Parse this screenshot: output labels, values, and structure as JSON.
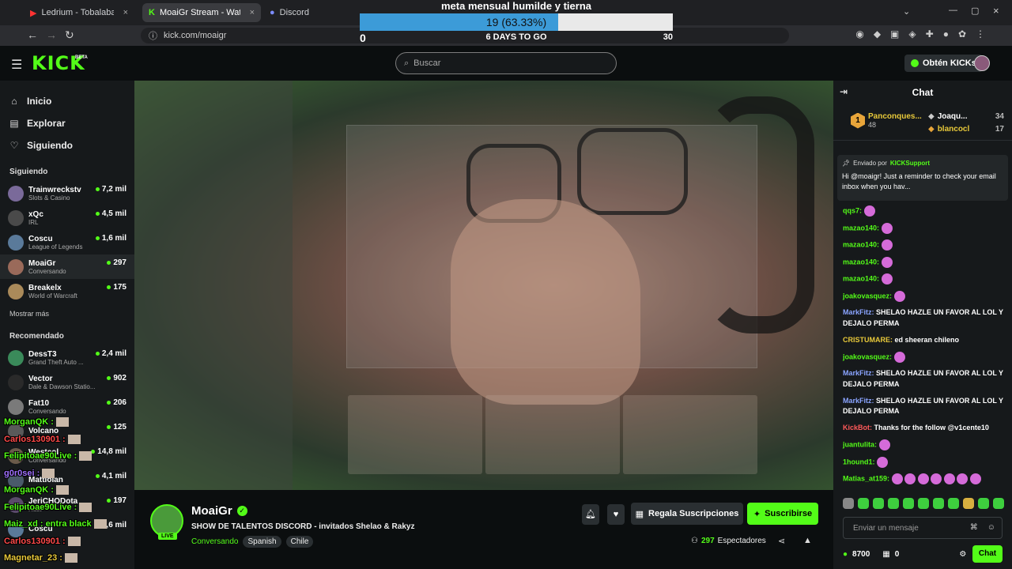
{
  "browser": {
    "tabs": [
      {
        "label": "Ledrium - Tobalaba, MUT, Av. P",
        "active": false
      },
      {
        "label": "MoaiGr Stream - Watch Liv",
        "active": true
      },
      {
        "label": "Discord",
        "active": false
      }
    ],
    "url": "kick.com/moaigr"
  },
  "goal": {
    "title": "meta mensual humilde y tierna",
    "progress_text": "19 (63.33%)",
    "progress_fraction": 0.6333,
    "days_left": "6 DAYS TO GO",
    "min": "0",
    "max": "30"
  },
  "header": {
    "logo": "KICK",
    "beta": "BETA",
    "search_placeholder": "Buscar",
    "get_kicks": "Obtén KICKs"
  },
  "sidebar": {
    "nav": [
      {
        "label": "Inicio",
        "icon": "home-icon",
        "glyph": "⌂"
      },
      {
        "label": "Explorar",
        "icon": "browse-icon",
        "glyph": "▤"
      },
      {
        "label": "Siguiendo",
        "icon": "heart-icon",
        "glyph": "♡"
      }
    ],
    "following_title": "Siguiendo",
    "following": [
      {
        "name": "Trainwreckstv",
        "category": "Slots & Casino",
        "viewers": "7,2 mil",
        "color": "#7a6a9a"
      },
      {
        "name": "xQc",
        "category": "IRL",
        "viewers": "4,5 mil",
        "color": "#4a4a4a"
      },
      {
        "name": "Coscu",
        "category": "League of Legends",
        "viewers": "1,6 mil",
        "color": "#5a7a9a"
      },
      {
        "name": "MoaiGr",
        "category": "Conversando",
        "viewers": "297",
        "color": "#9a6a5a"
      },
      {
        "name": "Breakelx",
        "category": "World of Warcraft",
        "viewers": "175",
        "color": "#aa8a5a"
      }
    ],
    "show_more": "Mostrar más",
    "recommended_title": "Recomendado",
    "recommended": [
      {
        "name": "DessT3",
        "category": "Grand Theft Auto ...",
        "viewers": "2,4 mil",
        "color": "#3a8a5a"
      },
      {
        "name": "Vector",
        "category": "Dale & Dawson Statio...",
        "viewers": "902",
        "color": "#2a2a2a"
      },
      {
        "name": "Fat10",
        "category": "Conversando",
        "viewers": "206",
        "color": "#7a7a7a"
      },
      {
        "name": "Volcano",
        "category": "",
        "viewers": "125",
        "color": "#5a5a5a"
      },
      {
        "name": "Westcol",
        "category": "Conversando",
        "viewers": "14,8 mil",
        "color": "#6a5a4a"
      },
      {
        "name": "Mattiolan",
        "category": "",
        "viewers": "4,1 mil",
        "color": "#4a5a6a"
      },
      {
        "name": "JeriCHODota",
        "category": "Rust",
        "viewers": "197",
        "color": "#5a4a6a"
      },
      {
        "name": "Coscu",
        "category": "",
        "viewers": "1,6 mil",
        "color": "#5a7a9a"
      }
    ]
  },
  "overlay_chat": [
    {
      "user": "MorganQK :",
      "color": "#53fc18"
    },
    {
      "user": "Carlos130901 :",
      "color": "#ff4a4a"
    },
    {
      "user": "Felipitoae90Live :",
      "color": "#53fc18"
    },
    {
      "user": "g0r0sei :",
      "color": "#a070ff"
    },
    {
      "user": "MorganQK :",
      "color": "#53fc18"
    },
    {
      "user": "Felipitoae90Live :",
      "color": "#53fc18"
    },
    {
      "user": "Maiz_xd : entra black",
      "color": "#53fc18"
    },
    {
      "user": "Carlos130901 :",
      "color": "#ff4a4a"
    },
    {
      "user": "Magnetar_23 :",
      "color": "#e8c93a"
    }
  ],
  "stream": {
    "name": "MoaiGr",
    "title": "SHOW DE TALENTOS DISCORD - invitados Shelao & Rakyz",
    "category": "Conversando",
    "tags": [
      "Spanish",
      "Chile"
    ],
    "live_label": "LIVE",
    "gift_label": "Regala Suscripciones",
    "subscribe_label": "Suscribirse",
    "viewers": "297",
    "viewers_label": "Espectadores"
  },
  "chat": {
    "title": "Chat",
    "leader_top": {
      "rank": "1",
      "name": "Panconques...",
      "count": "48"
    },
    "leader_rows": [
      {
        "name": "Joaqu...",
        "count": "34"
      },
      {
        "name": "blancocl",
        "count": "17"
      }
    ],
    "pinned": {
      "label": "Enviado por",
      "by": "KICKSupport",
      "text": "Hi @moaigr! Just a reminder to check your email inbox when you hav..."
    },
    "messages": [
      {
        "user": "qqs7:",
        "text": "",
        "emote": true,
        "cls": ""
      },
      {
        "user": "mazao140:",
        "text": "",
        "emote": true,
        "cls": ""
      },
      {
        "user": "mazao140:",
        "text": "",
        "emote": true,
        "cls": ""
      },
      {
        "user": "mazao140:",
        "text": "",
        "emote": true,
        "cls": ""
      },
      {
        "user": "mazao140:",
        "text": "",
        "emote": true,
        "cls": ""
      },
      {
        "user": "joakovasquez:",
        "text": "",
        "emote": true,
        "cls": ""
      },
      {
        "user": "MarkFitz:",
        "text": "SHELAO HAZLE UN FAVOR AL LOL Y DEJALO PERMA",
        "emote": false,
        "cls": "blue"
      },
      {
        "user": "CRISTUMARE:",
        "text": "ed sheeran chileno",
        "emote": false,
        "cls": "yellow"
      },
      {
        "user": "joakovasquez:",
        "text": "",
        "emote": true,
        "cls": ""
      },
      {
        "user": "MarkFitz:",
        "text": "SHELAO HAZLE UN FAVOR AL LOL Y DEJALO PERMA",
        "emote": false,
        "cls": "blue"
      },
      {
        "user": "MarkFitz:",
        "text": "SHELAO HAZLE UN FAVOR AL LOL Y DEJALO PERMA",
        "emote": false,
        "cls": "blue"
      },
      {
        "user": "KickBot:",
        "text": "Thanks for the follow @v1cente10",
        "emote": false,
        "cls": "red"
      },
      {
        "user": "juantulita:",
        "text": "",
        "emote": true,
        "cls": ""
      },
      {
        "user": "1hound1:",
        "text": "",
        "emote": true,
        "cls": ""
      },
      {
        "user": "Matias_at159:",
        "text": "",
        "emote": true,
        "cls": ""
      }
    ],
    "input_placeholder": "Enviar un mensaje",
    "points": "8700",
    "gift_count": "0",
    "send_label": "Chat"
  },
  "colors": {
    "brand": "#53fc18",
    "goal_fill": "#3c9bd8"
  }
}
